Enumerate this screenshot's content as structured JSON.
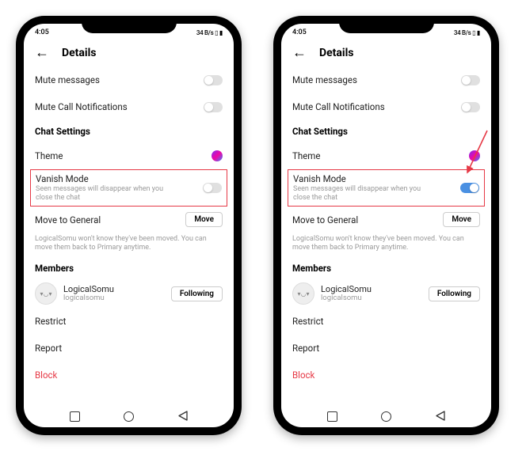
{
  "status": {
    "time": "4:05",
    "right": "34 B/s ▯ ▮"
  },
  "header": {
    "title": "Details"
  },
  "rows": {
    "mute_messages": "Mute messages",
    "mute_calls": "Mute Call Notifications",
    "chat_settings": "Chat Settings",
    "theme": "Theme",
    "vanish_title": "Vanish Mode",
    "vanish_sub": "Seen messages will disappear when you close the chat",
    "move_general": "Move to General",
    "move_btn": "Move",
    "move_helper": "LogicalSomu won't know they've been moved. You can move them back to Primary anytime.",
    "members": "Members",
    "restrict": "Restrict",
    "report": "Report",
    "block": "Block"
  },
  "member": {
    "name": "LogicalSomu",
    "handle": "logicalsomu",
    "follow_btn": "Following",
    "avatar_glyph": "▾◡▾"
  },
  "phones": [
    {
      "vanish_on": false,
      "show_arrow": false
    },
    {
      "vanish_on": true,
      "show_arrow": true
    }
  ]
}
